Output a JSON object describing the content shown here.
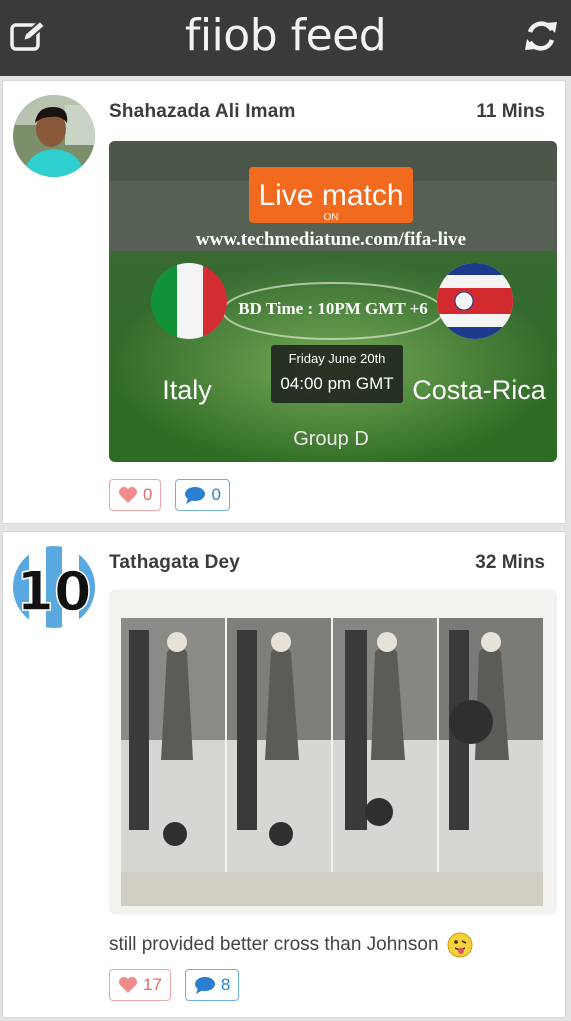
{
  "header": {
    "title": "fiiob feed",
    "left_icon": "compose-icon",
    "right_icon": "refresh-icon"
  },
  "colors": {
    "topbar": "#3a3a3a",
    "like": "#e06a6a",
    "comment": "#2b7fd1"
  },
  "posts": [
    {
      "author": "Shahazada Ali Imam",
      "time": "11 Mins",
      "image": {
        "badge": "Live match",
        "badge_sub": "ON",
        "url_text": "www.techmediatune.com/fifa-live",
        "bd_time": "BD Time : 10PM GMT +6",
        "date_line": "Friday June 20th",
        "time_line": "04:00 pm GMT",
        "team_left": "Italy",
        "team_right": "Costa-Rica",
        "group": "Group D"
      },
      "likes": "0",
      "comments": "0"
    },
    {
      "author": "Tathagata Dey",
      "time": "32 Mins",
      "avatar_number": "10",
      "caption": "still provided better cross than Johnson",
      "likes": "17",
      "comments": "8"
    }
  ]
}
